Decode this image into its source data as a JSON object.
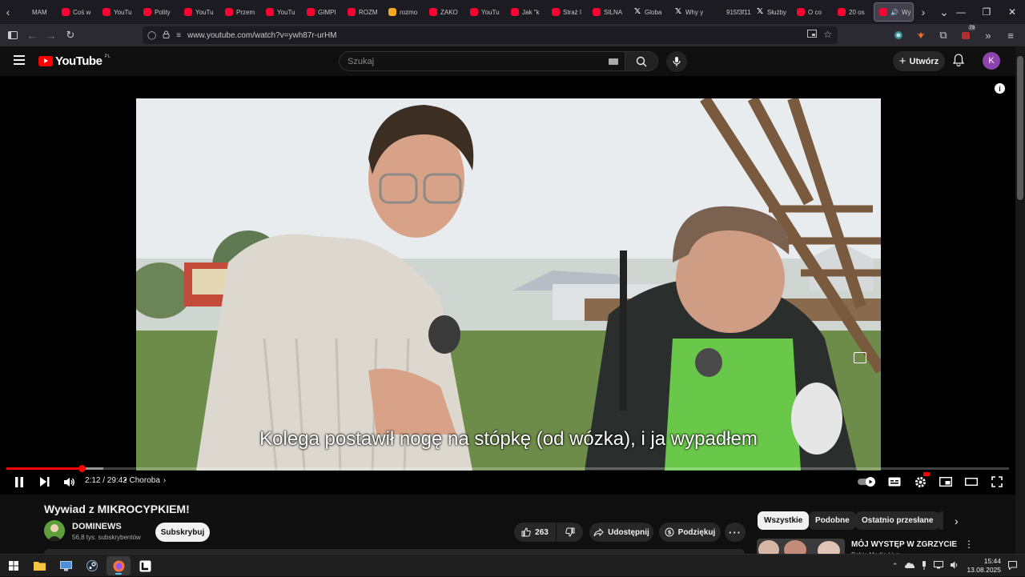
{
  "browser": {
    "tabs": [
      {
        "label": "MAM",
        "icon": "none"
      },
      {
        "label": "Coś w",
        "icon": "youtube"
      },
      {
        "label": "YouTu",
        "icon": "youtube"
      },
      {
        "label": "Polity",
        "icon": "youtube"
      },
      {
        "label": "YouTu",
        "icon": "youtube"
      },
      {
        "label": "Przem",
        "icon": "youtube"
      },
      {
        "label": "YouTu",
        "icon": "youtube"
      },
      {
        "label": "GIMPI",
        "icon": "youtube"
      },
      {
        "label": "ROZM",
        "icon": "youtube"
      },
      {
        "label": "rozmo",
        "icon": "jp"
      },
      {
        "label": "ZAKO",
        "icon": "youtube"
      },
      {
        "label": "YouTu",
        "icon": "youtube"
      },
      {
        "label": "Jak \"k",
        "icon": "youtube"
      },
      {
        "label": "Straż I",
        "icon": "youtube"
      },
      {
        "label": "SILNA",
        "icon": "youtube"
      },
      {
        "label": "Globa",
        "icon": "x"
      },
      {
        "label": "Why y",
        "icon": "x"
      },
      {
        "label": "915f3f112",
        "icon": "none"
      },
      {
        "label": "Służby",
        "icon": "x"
      },
      {
        "label": "O co",
        "icon": "youtube"
      },
      {
        "label": "20 os",
        "icon": "youtube"
      },
      {
        "label": "Wy",
        "icon": "youtube-audio"
      }
    ],
    "url": "www.youtube.com/watch?v=ywh87r-urHM",
    "extension_badge": "73"
  },
  "youtube": {
    "logo_text": "YouTube",
    "country_code": "PL",
    "search_placeholder": "Szukaj",
    "create_label": "Utwórz",
    "avatar_letter": "K"
  },
  "player": {
    "caption": "Kolega postawił nogę na stópkę (od wózka), i ja wypadłem",
    "current_time": "2:12",
    "duration": "29:42",
    "time_display": "2:12 / 29:42",
    "chapter": "Choroba",
    "progress_played": 0.0758,
    "progress_loaded": 0.097
  },
  "video": {
    "title": "Wywiad z MIKROCYPKIEM!",
    "channel": "DOMINEWS",
    "subscribers": "56,8 tys. subskrybentów",
    "subscribe_label": "Subskrybuj",
    "likes": "263",
    "share_label": "Udostępnij",
    "thanks_label": "Podziękuj"
  },
  "recommendations": {
    "chips": [
      "Wszystkie",
      "Podobne",
      "Ostatnio przesłane"
    ],
    "first": {
      "title": "MÓJ WYSTĘP W ZGRZYCIE",
      "channel": "Bobic Media Live"
    }
  },
  "taskbar": {
    "time": "15:44",
    "date": "13.08.2025"
  }
}
